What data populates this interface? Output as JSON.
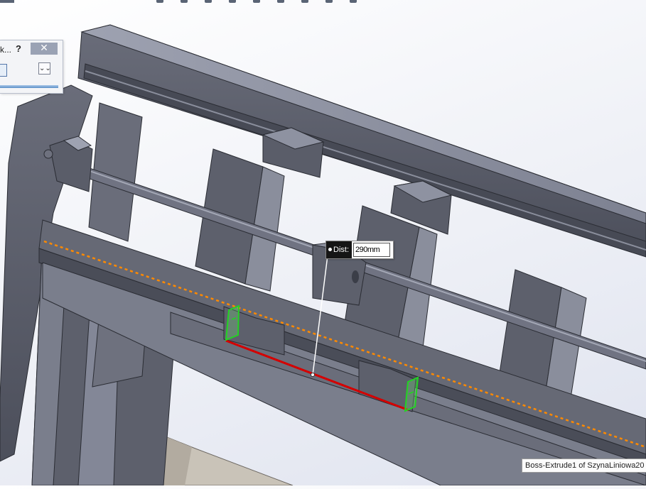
{
  "property_manager": {
    "title": "k...",
    "help_label": "?",
    "close_label": "✕",
    "expand_label": "⌄⌄"
  },
  "dimension": {
    "label": "Dist:",
    "value": "290mm"
  },
  "tooltip": {
    "text": "Boss-Extrude1 of SzynaLiniowa20"
  },
  "colors": {
    "model_body": "#5b5e6a",
    "selection_edge": "#d40000",
    "sketch_dashed": "#ff8a00",
    "selected_face": "#33dd33"
  }
}
